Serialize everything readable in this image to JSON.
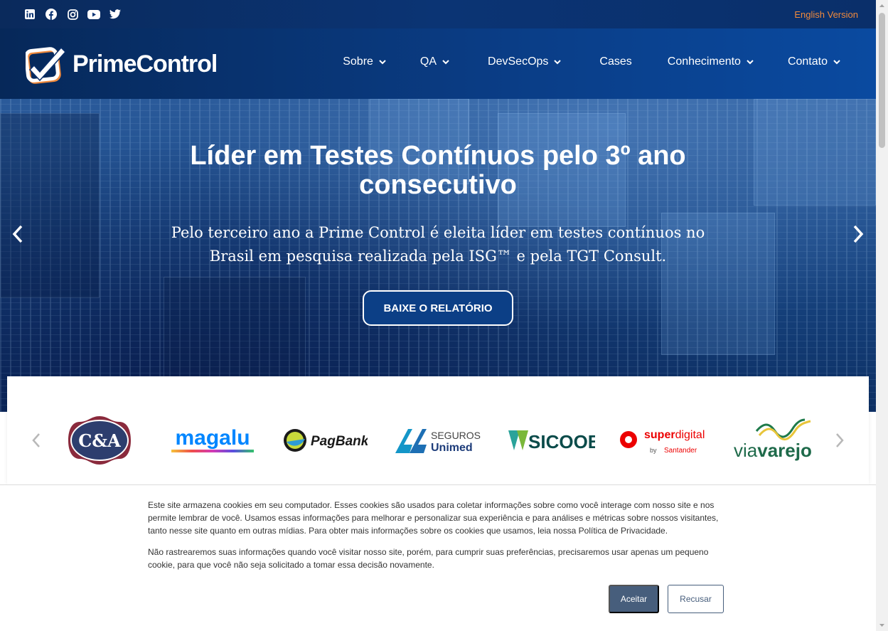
{
  "topbar": {
    "social_icons": [
      "linkedin-icon",
      "facebook-icon",
      "instagram-icon",
      "youtube-icon",
      "twitter-icon"
    ],
    "english_link": "English Version"
  },
  "nav": {
    "logo_text": "PrimeControl",
    "items": [
      {
        "label": "Sobre",
        "dropdown": true
      },
      {
        "label": "QA",
        "dropdown": true
      },
      {
        "label": "DevSecOps",
        "dropdown": true
      },
      {
        "label": "Cases",
        "dropdown": false
      },
      {
        "label": "Conhecimento",
        "dropdown": true
      },
      {
        "label": "Contato",
        "dropdown": true
      }
    ]
  },
  "hero": {
    "title_line1": "Líder em Testes Contínuos pelo 3º ano",
    "title_line2": "consecutivo",
    "subtitle_line1": "Pelo terceiro ano a Prime Control é eleita líder em testes contínuos no",
    "subtitle_line2": "Brasil em pesquisa realizada pela ISG™ e pela TGT Consult.",
    "button": "BAIXE O RELATÓRIO"
  },
  "clients": {
    "logos": {
      "ca": "C&A",
      "magalu": "magalu",
      "pagbank": "PagBank",
      "unimed_top": "SEGUROS",
      "unimed_bottom": "Unimed",
      "sicoob": "SICOOB",
      "superdigital_a": "super",
      "superdigital_b": "digital",
      "superdigital_by": "by",
      "superdigital_santander": "Santander",
      "viavarejo_a": "via",
      "viavarejo_b": "varejo"
    }
  },
  "cookie": {
    "paragraph1": "Este site armazena cookies em seu computador. Esses cookies são usados para coletar informações sobre como você interage com nosso site e nos permite lembrar de você. Usamos essas informações para melhorar e personalizar sua experiência e para análises e métricas sobre nossos visitantes, tanto nesse site quanto em outras mídias. Para obter mais informações sobre os cookies que usamos, leia nossa Política de Privacidade.",
    "paragraph2": "Não rastrearemos suas informações quando você visitar nosso site, porém, para cumprir suas preferências, precisaremos usar apenas um pequeno cookie, para que você não seja solicitado a tomar essa decisão novamente.",
    "accept": "Aceitar",
    "refuse": "Recusar"
  },
  "colors": {
    "accent_orange": "#f08a3c",
    "nav_blue": "#0a3c84",
    "button_slate": "#475e7c"
  }
}
